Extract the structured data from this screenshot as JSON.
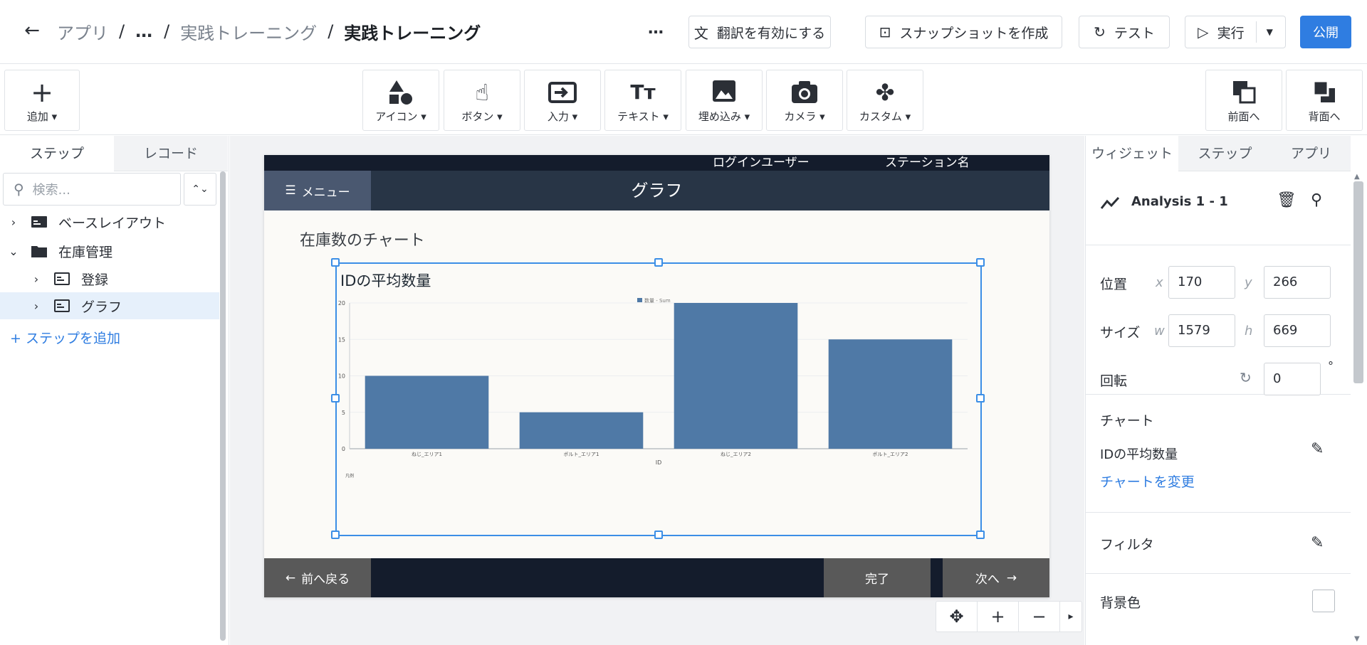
{
  "header": {
    "breadcrumb": [
      "アプリ",
      "…",
      "実践トレーニング",
      "実践トレーニング"
    ],
    "separator": "/",
    "more": "…",
    "translate_label": "翻訳を有効にする",
    "snapshot_label": "スナップショットを作成",
    "test_label": "テスト",
    "run_label": "実行",
    "publish_label": "公開"
  },
  "toolbar": {
    "add_label": "追加",
    "items": [
      "アイコン",
      "ボタン",
      "入力",
      "テキスト",
      "埋め込み",
      "カメラ",
      "カスタム"
    ],
    "front_label": "前面へ",
    "back_label": "背面へ"
  },
  "left_panel": {
    "tabs": [
      "ステップ",
      "レコード"
    ],
    "search_placeholder": "検索...",
    "tree": [
      {
        "label": "ベースレイアウト",
        "level": 0
      },
      {
        "label": "在庫管理",
        "level": 0
      },
      {
        "label": "登録",
        "level": 1
      },
      {
        "label": "グラフ",
        "level": 1
      }
    ],
    "add_step": "ステップを追加"
  },
  "canvas": {
    "top_user": "ログインユーザー",
    "top_station": "ステーション名",
    "menu_label": "メニュー",
    "screen_title": "グラフ",
    "heading": "在庫数のチャート",
    "prev_label": "前へ戻る",
    "done_label": "完了",
    "next_label": "次へ"
  },
  "chart_data": {
    "type": "bar",
    "title": "IDの平均数量",
    "categories": [
      "ねじ_エリア1",
      "ボルト_エリア1",
      "ねじ_エリア2",
      "ボルト_エリア2"
    ],
    "series": [
      {
        "name": "数量 - Sum",
        "values": [
          10,
          5,
          20,
          15
        ]
      }
    ],
    "xlabel": "ID",
    "ylabel": "",
    "ylim": [
      0,
      20
    ],
    "yticks": [
      0,
      5,
      10,
      15,
      20
    ],
    "footer_note": "凡例",
    "color": "#4f79a6",
    "grid": true,
    "legend_position": "top-center"
  },
  "right_panel": {
    "tabs": [
      "ウィジェット",
      "ステップ",
      "アプリ"
    ],
    "widget_name": "Analysis 1 - 1",
    "position_label": "位置",
    "x_key": "x",
    "x_value": "170",
    "y_key": "y",
    "y_value": "266",
    "size_label": "サイズ",
    "w_key": "w",
    "w_value": "1579",
    "h_key": "h",
    "h_value": "669",
    "rotation_label": "回転",
    "rotation_value": "0",
    "degree": "°",
    "chart_label": "チャート",
    "chart_name": "IDの平均数量",
    "change_chart": "チャートを変更",
    "filter_label": "フィルタ",
    "bg_label": "背景色"
  }
}
